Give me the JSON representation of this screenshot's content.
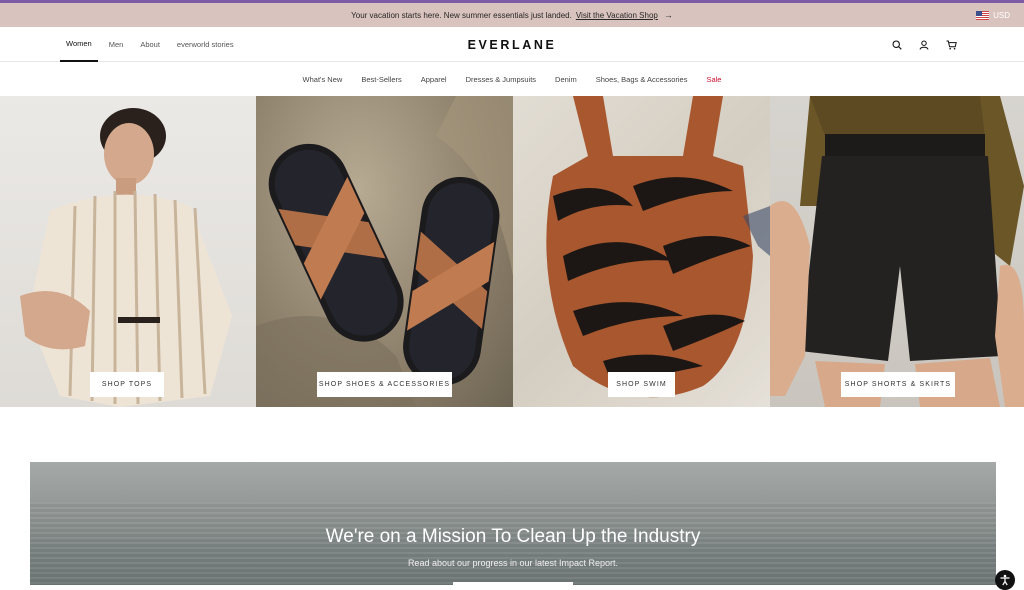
{
  "promo": {
    "text": "Your vacation starts here. New summer essentials just landed.",
    "link": "Visit the Vacation Shop",
    "arrow": "→",
    "currency": "USD"
  },
  "header": {
    "nav_left": [
      "Women",
      "Men",
      "About",
      "everworld stories"
    ],
    "logo": "EVERLANE",
    "icons": [
      "search-icon",
      "account-icon",
      "cart-icon"
    ]
  },
  "categories": [
    "What's New",
    "Best-Sellers",
    "Apparel",
    "Dresses & Jumpsuits",
    "Denim",
    "Shoes, Bags & Accessories",
    "Sale"
  ],
  "tiles": [
    {
      "button": "SHOP TOPS"
    },
    {
      "button": "SHOP SHOES & ACCESSORIES"
    },
    {
      "button": "SHOP SWIM"
    },
    {
      "button": "SHOP SHORTS & SKIRTS"
    }
  ],
  "mission": {
    "title": "We're on a Mission To Clean Up the Industry",
    "subtitle": "Read about our progress in our latest Impact Report."
  },
  "colors": {
    "promo_bg": "#d9c3be",
    "topline": "#7e5ba6",
    "sale": "#c8102e"
  }
}
